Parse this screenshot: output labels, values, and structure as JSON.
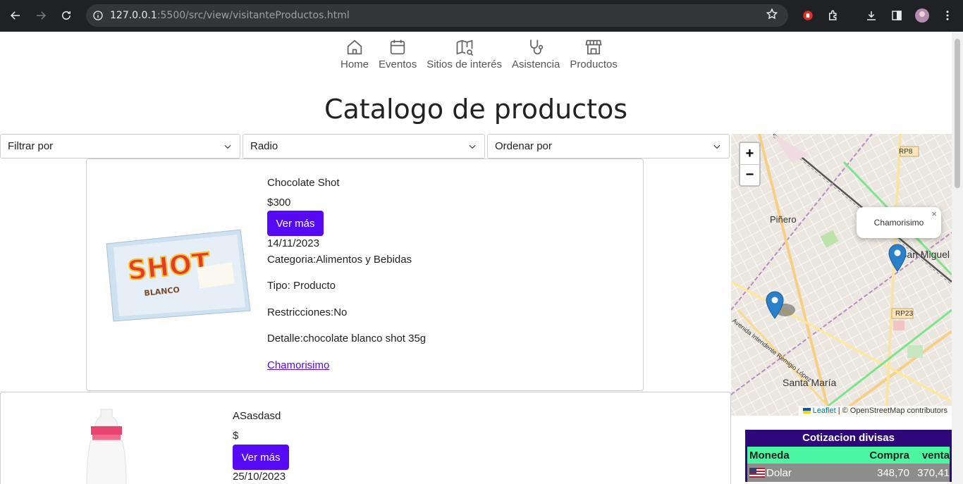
{
  "browser": {
    "url_host": "127.0.0.1",
    "url_rest": ":5500/src/view/visitanteProductos.html"
  },
  "nav": {
    "items": [
      {
        "label": "Home",
        "icon": "home-icon"
      },
      {
        "label": "Eventos",
        "icon": "calendar-icon"
      },
      {
        "label": "Sitios de interés",
        "icon": "map-search-icon"
      },
      {
        "label": "Asistencia",
        "icon": "stethoscope-icon"
      },
      {
        "label": "Productos",
        "icon": "store-icon"
      }
    ]
  },
  "page_title": "Catalogo de productos",
  "filters": {
    "filter_by": "Filtrar por",
    "radius": "Radio",
    "order_by": "Ordenar por"
  },
  "products": [
    {
      "name": "Chocolate Shot",
      "price": "$300",
      "button": "Ver más",
      "date": "14/11/2023",
      "category": "Categoria:Alimentos y Bebidas",
      "type": "Tipo: Producto",
      "restrictions": "Restricciones:No",
      "detail": "Detalle:chocolate blanco shot 35g",
      "store_link": "Chamorisimo"
    },
    {
      "name": "ASasdasd",
      "price": "$",
      "button": "Ver más",
      "date": "25/10/2023"
    }
  ],
  "map": {
    "zoom_in": "+",
    "zoom_out": "−",
    "popup_text": "Chamorisimo",
    "popup_close": "×",
    "labels": {
      "pinero": "Piñero",
      "san_miguel": "San Miguel",
      "santa_maria": "Santa María",
      "rp8": "RP8",
      "rp23": "RP23",
      "avenida": "Avenida Intendente Remigio López"
    },
    "attribution_leaflet": "Leaflet",
    "attribution_rest": "| © OpenStreetMap contributors"
  },
  "currency": {
    "title": "Cotizacion divisas",
    "headers": {
      "moneda": "Moneda",
      "compra": "Compra",
      "venta": "venta"
    },
    "rows": [
      {
        "moneda": "Dolar",
        "compra": "348,70",
        "venta": "370,41"
      }
    ]
  }
}
